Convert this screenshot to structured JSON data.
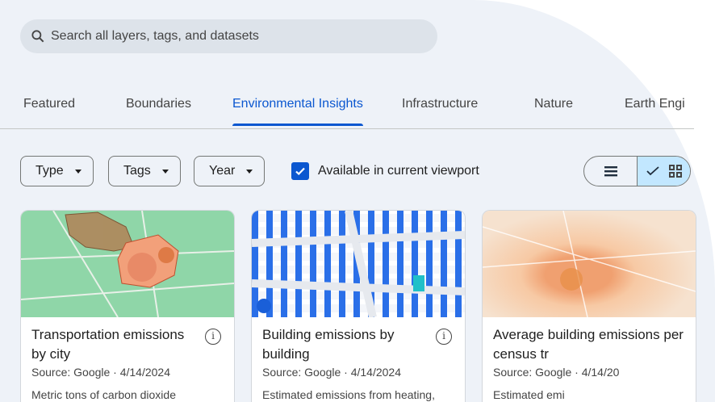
{
  "search": {
    "placeholder": "Search all layers, tags, and datasets"
  },
  "tabs": [
    "Featured",
    "Boundaries",
    "Environmental Insights",
    "Infrastructure",
    "Nature",
    "Earth Engi"
  ],
  "active_tab": "Environmental Insights",
  "filters": {
    "type": "Type",
    "tags": "Tags",
    "year": "Year"
  },
  "viewport_checkbox": {
    "label": "Available in current viewport",
    "checked": true
  },
  "view_toggle": {
    "selected": "grid"
  },
  "cards": [
    {
      "title": "Transportation emissions by city",
      "source": "Source: Google · 4/14/2024",
      "description": "Metric tons of carbon dioxide"
    },
    {
      "title": "Building emissions by building",
      "source": "Source: Google · 4/14/2024",
      "description": "Estimated emissions from heating,"
    },
    {
      "title": "Average building emissions per census tr",
      "source": "Source: Google · 4/14/20",
      "description": "Estimated emi"
    }
  ],
  "colors": {
    "accent": "#0b57d0",
    "panel": "#eef2f8",
    "toggle_selected": "#c2e7ff"
  }
}
